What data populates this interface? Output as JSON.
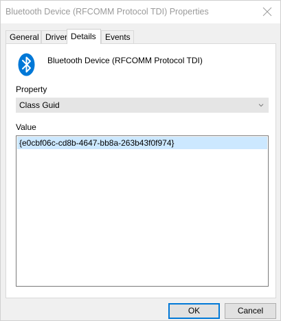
{
  "window": {
    "title": "Bluetooth Device (RFCOMM Protocol TDI) Properties",
    "close_icon": "close-icon"
  },
  "tabs": [
    {
      "label": "General",
      "active": false
    },
    {
      "label": "Driver",
      "active": false
    },
    {
      "label": "Details",
      "active": true
    },
    {
      "label": "Events",
      "active": false
    }
  ],
  "device": {
    "name": "Bluetooth Device (RFCOMM Protocol TDI)",
    "icon": "bluetooth-icon",
    "icon_color": "#0078d7"
  },
  "property": {
    "label": "Property",
    "selected": "Class Guid"
  },
  "value": {
    "label": "Value",
    "items": [
      "{e0cbf06c-cd8b-4647-bb8a-263b43f0f974}"
    ],
    "selected_bg": "#cce8ff"
  },
  "buttons": {
    "ok": "OK",
    "cancel": "Cancel"
  },
  "colors": {
    "accent": "#0078d7"
  }
}
